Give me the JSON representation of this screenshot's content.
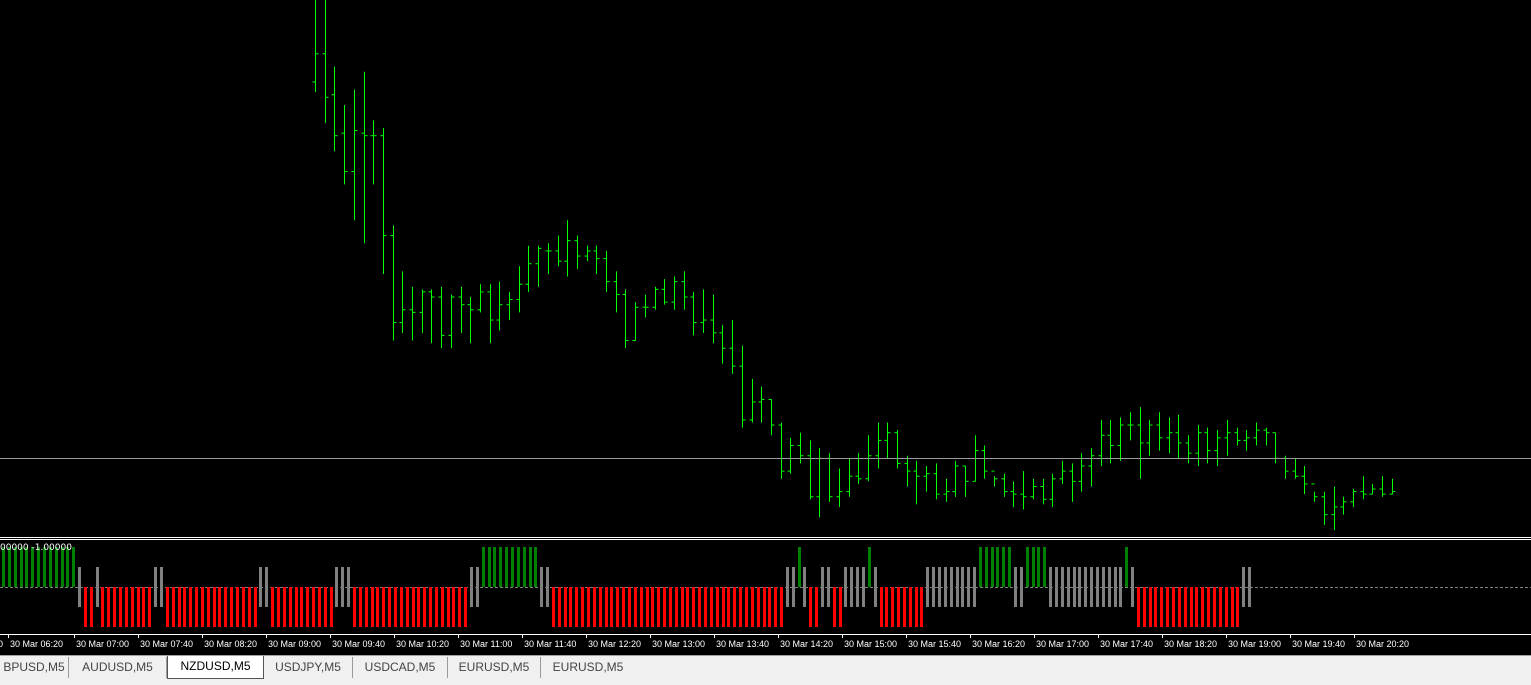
{
  "chart": {
    "symbol": "NZDUSD",
    "timeframe": "M5",
    "bar_color": "#00ff00",
    "background": "#000000",
    "bars": [
      [
        0.523,
        0.5262,
        0.5226,
        0.5241
      ],
      [
        0.5241,
        0.5268,
        0.5214,
        0.5224
      ],
      [
        0.5225,
        0.5236,
        0.5203,
        0.5209
      ],
      [
        0.521,
        0.5221,
        0.519,
        0.5195
      ],
      [
        0.5195,
        0.5227,
        0.5176,
        0.5211
      ],
      [
        0.521,
        0.5234,
        0.5167,
        0.5209
      ],
      [
        0.5209,
        0.5215,
        0.519,
        0.5209
      ],
      [
        0.5209,
        0.5212,
        0.5155,
        0.517
      ],
      [
        0.517,
        0.5174,
        0.5129,
        0.5136
      ],
      [
        0.5136,
        0.5156,
        0.5132,
        0.5141
      ],
      [
        0.5141,
        0.515,
        0.5129,
        0.514
      ],
      [
        0.514,
        0.5149,
        0.5132,
        0.5148
      ],
      [
        0.5148,
        0.5149,
        0.5128,
        0.5146
      ],
      [
        0.5146,
        0.515,
        0.5126,
        0.5131
      ],
      [
        0.5131,
        0.5147,
        0.5126,
        0.5146
      ],
      [
        0.5146,
        0.515,
        0.5132,
        0.5143
      ],
      [
        0.5143,
        0.5146,
        0.5128,
        0.5141
      ],
      [
        0.5141,
        0.5151,
        0.514,
        0.5148
      ],
      [
        0.5148,
        0.5151,
        0.5128,
        0.5137
      ],
      [
        0.5137,
        0.5152,
        0.5133,
        0.5143
      ],
      [
        0.5143,
        0.5148,
        0.5137,
        0.5145
      ],
      [
        0.5145,
        0.5158,
        0.514,
        0.5151
      ],
      [
        0.5151,
        0.5166,
        0.5148,
        0.5159
      ],
      [
        0.5159,
        0.5166,
        0.515,
        0.5165
      ],
      [
        0.5164,
        0.5167,
        0.5155,
        0.5164
      ],
      [
        0.5164,
        0.517,
        0.5158,
        0.516
      ],
      [
        0.516,
        0.5176,
        0.5154,
        0.5168
      ],
      [
        0.5168,
        0.517,
        0.5157,
        0.5162
      ],
      [
        0.5162,
        0.5166,
        0.516,
        0.5164
      ],
      [
        0.5164,
        0.5166,
        0.5155,
        0.5161
      ],
      [
        0.5161,
        0.5164,
        0.5148,
        0.5152
      ],
      [
        0.5152,
        0.5156,
        0.514,
        0.5147
      ],
      [
        0.5147,
        0.5149,
        0.5126,
        0.5129
      ],
      [
        0.5129,
        0.5144,
        0.5129,
        0.5142
      ],
      [
        0.5142,
        0.5147,
        0.5138,
        0.5142
      ],
      [
        0.5142,
        0.515,
        0.5141,
        0.5149
      ],
      [
        0.5149,
        0.5153,
        0.5143,
        0.5144
      ],
      [
        0.5144,
        0.5154,
        0.5141,
        0.5152
      ],
      [
        0.5152,
        0.5156,
        0.5141,
        0.5146
      ],
      [
        0.5146,
        0.5148,
        0.5131,
        0.5136
      ],
      [
        0.5136,
        0.5149,
        0.5132,
        0.5137
      ],
      [
        0.5137,
        0.5147,
        0.5128,
        0.5132
      ],
      [
        0.5132,
        0.5135,
        0.512,
        0.5126
      ],
      [
        0.5126,
        0.5137,
        0.5116,
        0.5119
      ],
      [
        0.5119,
        0.5127,
        0.5095,
        0.5098
      ],
      [
        0.5098,
        0.5114,
        0.5097,
        0.5105
      ],
      [
        0.5105,
        0.5111,
        0.5097,
        0.5106
      ],
      [
        0.5106,
        0.5106,
        0.5092,
        0.5096
      ],
      [
        0.5096,
        0.5097,
        0.5075,
        0.5078
      ],
      [
        0.5078,
        0.5091,
        0.5077,
        0.5088
      ],
      [
        0.5088,
        0.5093,
        0.5081,
        0.5084
      ],
      [
        0.5084,
        0.509,
        0.5067,
        0.5068
      ],
      [
        0.5068,
        0.5087,
        0.506,
        0.5083
      ],
      [
        0.5083,
        0.5085,
        0.5066,
        0.5068
      ],
      [
        0.5068,
        0.5079,
        0.5064,
        0.507
      ],
      [
        0.507,
        0.5083,
        0.5068,
        0.5076
      ],
      [
        0.5076,
        0.5085,
        0.5073,
        0.5075
      ],
      [
        0.5075,
        0.5092,
        0.5074,
        0.5084
      ],
      [
        0.5084,
        0.5097,
        0.5079,
        0.509
      ],
      [
        0.509,
        0.5097,
        0.5083,
        0.5093
      ],
      [
        0.5093,
        0.5094,
        0.5079,
        0.5081
      ],
      [
        0.5081,
        0.5084,
        0.5072,
        0.5078
      ],
      [
        0.5078,
        0.5082,
        0.5065,
        0.5076
      ],
      [
        0.5076,
        0.508,
        0.507,
        0.5077
      ],
      [
        0.5077,
        0.5081,
        0.5067,
        0.5069
      ],
      [
        0.5069,
        0.5075,
        0.5066,
        0.507
      ],
      [
        0.507,
        0.5082,
        0.5068,
        0.508
      ],
      [
        0.508,
        0.508,
        0.5068,
        0.5074
      ],
      [
        0.5074,
        0.5092,
        0.5074,
        0.5086
      ],
      [
        0.5086,
        0.5088,
        0.5075,
        0.5078
      ],
      [
        0.5078,
        0.5076,
        0.5072,
        0.5075
      ],
      [
        0.5075,
        0.5077,
        0.5068,
        0.507
      ],
      [
        0.507,
        0.5074,
        0.5064,
        0.5069
      ],
      [
        0.5069,
        0.5078,
        0.5063,
        0.5068
      ],
      [
        0.5068,
        0.5075,
        0.5067,
        0.5072
      ],
      [
        0.5072,
        0.5075,
        0.5065,
        0.5067
      ],
      [
        0.5067,
        0.5077,
        0.5064,
        0.5075
      ],
      [
        0.5075,
        0.5082,
        0.5073,
        0.5078
      ],
      [
        0.5078,
        0.5081,
        0.5066,
        0.5074
      ],
      [
        0.5074,
        0.5085,
        0.507,
        0.508
      ],
      [
        0.508,
        0.5087,
        0.5072,
        0.5084
      ],
      [
        0.5084,
        0.5098,
        0.508,
        0.5092
      ],
      [
        0.5092,
        0.5098,
        0.5081,
        0.5088
      ],
      [
        0.5088,
        0.5099,
        0.5082,
        0.5096
      ],
      [
        0.5096,
        0.5101,
        0.509,
        0.5096
      ],
      [
        0.5096,
        0.5103,
        0.5075,
        0.5089
      ],
      [
        0.5089,
        0.5098,
        0.5084,
        0.5096
      ],
      [
        0.5096,
        0.5101,
        0.5086,
        0.5091
      ],
      [
        0.5091,
        0.5099,
        0.5085,
        0.5093
      ],
      [
        0.5093,
        0.51,
        0.5083,
        0.5089
      ],
      [
        0.5089,
        0.5092,
        0.5081,
        0.5085
      ],
      [
        0.5085,
        0.5096,
        0.508,
        0.5093
      ],
      [
        0.5093,
        0.5095,
        0.5081,
        0.5086
      ],
      [
        0.5086,
        0.5094,
        0.508,
        0.5091
      ],
      [
        0.5091,
        0.5098,
        0.5084,
        0.5093
      ],
      [
        0.5093,
        0.5095,
        0.5088,
        0.509
      ],
      [
        0.509,
        0.5094,
        0.5086,
        0.5091
      ],
      [
        0.5091,
        0.5097,
        0.5088,
        0.5094
      ],
      [
        0.5094,
        0.5095,
        0.5088,
        0.5093
      ],
      [
        0.5093,
        0.5093,
        0.5081,
        0.5083
      ],
      [
        0.5083,
        0.5084,
        0.5075,
        0.5078
      ],
      [
        0.5078,
        0.5083,
        0.5075,
        0.5076
      ],
      [
        0.5076,
        0.508,
        0.5069,
        0.5073
      ],
      [
        0.5073,
        0.507,
        0.5066,
        0.5068
      ],
      [
        0.5068,
        0.507,
        0.5057,
        0.5061
      ],
      [
        0.5061,
        0.5072,
        0.5055,
        0.5064
      ],
      [
        0.5064,
        0.5068,
        0.5061,
        0.5066
      ],
      [
        0.5066,
        0.5071,
        0.5064,
        0.507
      ],
      [
        0.507,
        0.5076,
        0.5067,
        0.5069
      ],
      [
        0.5069,
        0.5073,
        0.5069,
        0.5071
      ],
      [
        0.5071,
        0.5076,
        0.5068,
        0.5069
      ],
      [
        0.5069,
        0.5075,
        0.5069,
        0.507
      ]
    ],
    "price_line": 0.5069
  },
  "indicator": {
    "label": "00000 -1.00000",
    "colors": {
      "up": "#008000",
      "neutral": "#808080",
      "down": "#ff0000"
    },
    "histogram": [
      1,
      1,
      1,
      1,
      1,
      1,
      1,
      1,
      1,
      1,
      1,
      1,
      1,
      0,
      -1,
      -1,
      0,
      -1,
      -1,
      -1,
      -1,
      -1,
      -1,
      -1,
      -1,
      -1,
      0,
      0,
      -1,
      -1,
      -1,
      -1,
      -1,
      -1,
      -1,
      -1,
      -1,
      -1,
      -1,
      -1,
      -1,
      -1,
      -1,
      -1,
      0,
      0,
      -1,
      -1,
      -1,
      -1,
      -1,
      -1,
      -1,
      -1,
      -1,
      -1,
      -1,
      0,
      0,
      0,
      -1,
      -1,
      -1,
      -1,
      -1,
      -1,
      -1,
      -1,
      -1,
      -1,
      -1,
      -1,
      -1,
      -1,
      -1,
      -1,
      -1,
      -1,
      -1,
      -1,
      0,
      0,
      1,
      1,
      1,
      1,
      1,
      1,
      1,
      1,
      1,
      1,
      0,
      0,
      -1,
      -1,
      -1,
      -1,
      -1,
      -1,
      -1,
      -1,
      -1,
      -1,
      -1,
      -1,
      -1,
      -1,
      -1,
      -1,
      -1,
      -1,
      -1,
      -1,
      -1,
      -1,
      -1,
      -1,
      -1,
      -1,
      -1,
      -1,
      -1,
      -1,
      -1,
      -1,
      -1,
      -1,
      -1,
      -1,
      -1,
      -1,
      -1,
      -1,
      0,
      0,
      1,
      0,
      -1,
      -1,
      0,
      0,
      -1,
      -1,
      0,
      0,
      0,
      0,
      1,
      0,
      -1,
      -1,
      -1,
      -1,
      -1,
      -1,
      -1,
      -1,
      0,
      0,
      0,
      0,
      0,
      0,
      0,
      0,
      0,
      1,
      1,
      1,
      1,
      1,
      1,
      0,
      0,
      1,
      1,
      1,
      1,
      0,
      0,
      0,
      0,
      0,
      0,
      0,
      0,
      0,
      0,
      0,
      0,
      0,
      1,
      0,
      -1,
      -1,
      -1,
      -1,
      -1,
      -1,
      -1,
      -1,
      -1,
      -1,
      -1,
      -1,
      -1,
      -1,
      -1,
      -1,
      -1,
      -1,
      0,
      0
    ]
  },
  "time_axis": {
    "labels": [
      "0",
      "30 Mar 06:20",
      "30 Mar 07:00",
      "30 Mar 07:40",
      "30 Mar 08:20",
      "30 Mar 09:00",
      "30 Mar 09:40",
      "30 Mar 10:20",
      "30 Mar 11:00",
      "30 Mar 11:40",
      "30 Mar 12:20",
      "30 Mar 13:00",
      "30 Mar 13:40",
      "30 Mar 14:20",
      "30 Mar 15:00",
      "30 Mar 15:40",
      "30 Mar 16:20",
      "30 Mar 17:00",
      "30 Mar 17:40",
      "30 Mar 18:20",
      "30 Mar 19:00",
      "30 Mar 19:40",
      "30 Mar 20:20"
    ]
  },
  "tabs": [
    {
      "label": "BPUSD,M5",
      "active": false
    },
    {
      "label": "AUDUSD,M5",
      "active": false
    },
    {
      "label": "NZDUSD,M5",
      "active": true
    },
    {
      "label": "USDJPY,M5",
      "active": false
    },
    {
      "label": "USDCAD,M5",
      "active": false
    },
    {
      "label": "EURUSD,M5",
      "active": false
    },
    {
      "label": "EURUSD,M5",
      "active": false
    }
  ]
}
